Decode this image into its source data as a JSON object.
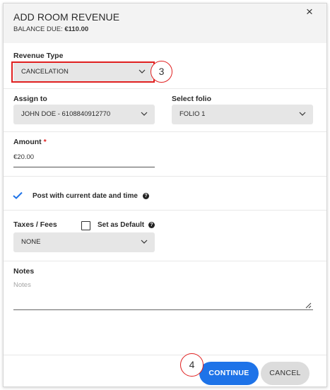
{
  "header": {
    "title": "ADD ROOM REVENUE",
    "balance_label": "BALANCE DUE: ",
    "balance_value": "€110.00",
    "close_glyph": "×"
  },
  "revenue_type": {
    "label": "Revenue Type",
    "value": "CANCELATION",
    "step": "3"
  },
  "assign_to": {
    "label": "Assign to",
    "value": "JOHN DOE - 6108840912770"
  },
  "folio": {
    "label": "Select folio",
    "value": "FOLIO 1"
  },
  "amount": {
    "label": "Amount",
    "required_mark": "*",
    "value": "€20.00"
  },
  "post": {
    "checked": true,
    "label": "Post with current date and time",
    "help_glyph": "?"
  },
  "taxes": {
    "label": "Taxes / Fees",
    "default_label": "Set as Default",
    "default_checked": false,
    "help_glyph": "?",
    "value": "NONE"
  },
  "notes": {
    "label": "Notes",
    "placeholder": "Notes"
  },
  "footer": {
    "continue_label": "CONTINUE",
    "cancel_label": "CANCEL",
    "step": "4"
  },
  "colors": {
    "accent_blue": "#1e73e8",
    "highlight_red": "#e02020",
    "header_bg": "#f3f3f3",
    "select_bg": "#e6e6e6"
  },
  "icons": [
    "close-icon",
    "chevron-down-icon",
    "check-icon",
    "help-icon",
    "resize-handle-icon"
  ]
}
